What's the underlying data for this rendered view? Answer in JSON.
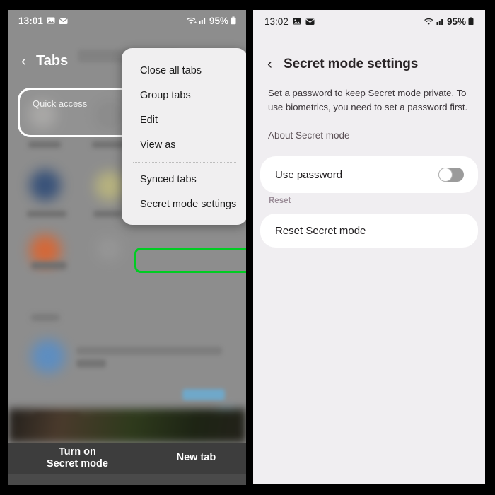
{
  "left_panel": {
    "status_bar": {
      "time": "13:01",
      "icons": [
        "image-icon",
        "mail-icon"
      ],
      "right_icons": [
        "wifi-icon",
        "signal-icon"
      ],
      "battery_percent": "95%"
    },
    "header": {
      "back_icon": "chevron-left-icon",
      "title": "Tabs"
    },
    "quick_access": {
      "label": "Quick access"
    },
    "bottom_bar": {
      "secret_mode_line1": "Turn on",
      "secret_mode_line2": "Secret mode",
      "new_tab": "New tab"
    }
  },
  "popup_menu": {
    "items": [
      {
        "label": "Close all tabs",
        "highlighted": false
      },
      {
        "label": "Group tabs",
        "highlighted": false
      },
      {
        "label": "Edit",
        "highlighted": false
      },
      {
        "label": "View as",
        "highlighted": false
      },
      {
        "label": "Synced tabs",
        "highlighted": false
      },
      {
        "label": "Secret mode settings",
        "highlighted": true
      }
    ],
    "highlight_color": "#00cc22"
  },
  "right_panel": {
    "status_bar": {
      "time": "13:02",
      "icons": [
        "image-icon",
        "mail-icon"
      ],
      "right_icons": [
        "wifi-icon",
        "signal-icon"
      ],
      "battery_percent": "95%"
    },
    "header": {
      "back_icon": "chevron-left-icon",
      "title": "Secret mode settings"
    },
    "description": "Set a password to keep Secret mode private. To use biometrics, you need to set a password first.",
    "about_link": "About Secret mode",
    "use_password": {
      "label": "Use password",
      "state": "off"
    },
    "reset_group_label": "Reset",
    "reset_item": "Reset Secret mode"
  }
}
